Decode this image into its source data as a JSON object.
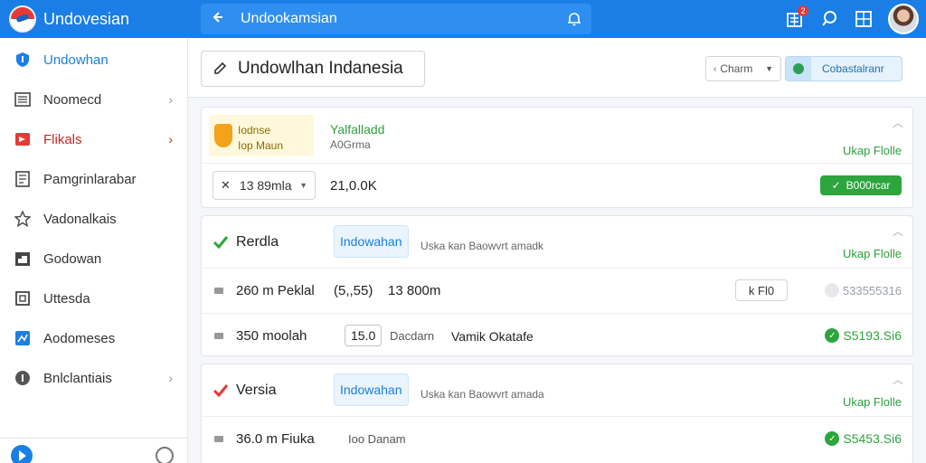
{
  "app": {
    "brand_name": "Undovesian",
    "search_title": "Undookamsian",
    "notification_count": "2",
    "colors": {
      "primary": "#1a7ee6",
      "success": "#2ca53d",
      "danger": "#e53935",
      "warning": "#f3a31b"
    }
  },
  "sidebar": {
    "items": [
      {
        "label": "Undowhan",
        "icon": "shield-icon",
        "state": "active"
      },
      {
        "label": "Noomecd",
        "icon": "list-icon",
        "chevron": true
      },
      {
        "label": "Flikals",
        "icon": "flag-icon",
        "chevron": true,
        "state": "alert"
      },
      {
        "label": "Pamgrinlarabar",
        "icon": "document-icon"
      },
      {
        "label": "Vadonalkais",
        "icon": "star-icon"
      },
      {
        "label": "Godowan",
        "icon": "calendar-icon"
      },
      {
        "label": "Uttesda",
        "icon": "square-icon"
      },
      {
        "label": "Aodomeses",
        "icon": "image-icon"
      },
      {
        "label": "Bnlclantiais",
        "icon": "info-icon",
        "chevron": true
      }
    ]
  },
  "header": {
    "title": "Undowlhan Indanesia",
    "select_value": "Charm",
    "action_label": "Cobastalranr"
  },
  "cards": {
    "first": {
      "badge_line1": "Iodnse",
      "badge_line2": "Iop Maun",
      "title": "Yalfalladd",
      "subtitle": "A0Grma",
      "status": "Ukap Flolle",
      "dropdown_value": "13 89mla",
      "amount": "21,0.0K",
      "button_label": "B000rcar"
    },
    "second": {
      "title": "Rerdla",
      "pill": "Indowahan",
      "subtext": "Uska kan Baowvrt amadk",
      "status": "Ukap Flolle",
      "row1": {
        "name": "260 m Peklal",
        "value": "(5,,55)",
        "extra": "13 800m",
        "button": "k Fl0",
        "ghost_value": "533555316"
      },
      "row2": {
        "name": "350 moolah",
        "boxed": "15.0",
        "gray": "Dacdarn",
        "extra": "Vamik Okatafe",
        "green_value": "S5193.Si6"
      }
    },
    "third": {
      "title": "Versia",
      "pill": "Indowahan",
      "subtext": "Uska kan Baowvrt amada",
      "status": "Ukap Flolle",
      "row1": {
        "name": "36.0 m Fiuka",
        "gray": "Ioo Danam",
        "green_value": "S5453.Si6"
      }
    }
  }
}
